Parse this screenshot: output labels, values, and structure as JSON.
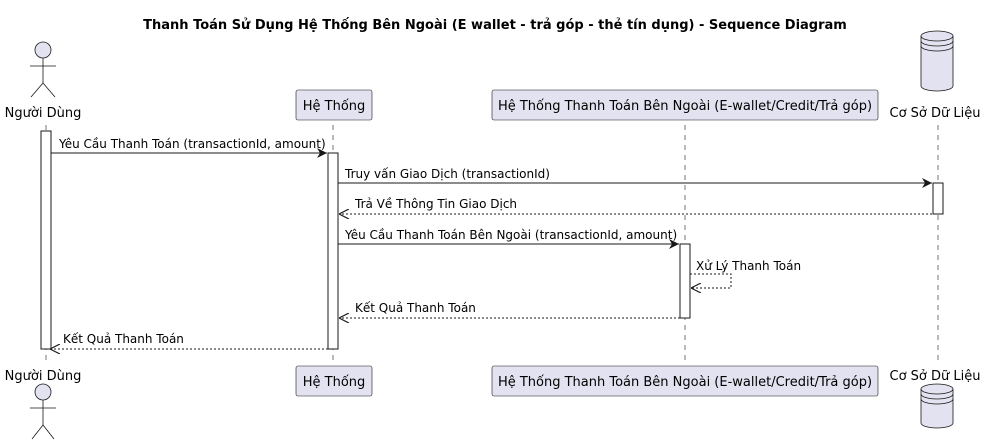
{
  "diagram": {
    "title": "Thanh Toán Sử Dụng Hệ Thống Bên Ngoài (E wallet - trả góp - thẻ tín dụng) - Sequence Diagram",
    "colors": {
      "participant_fill": "#E2E2F0",
      "line": "#181818",
      "background": "#FFFFFF"
    },
    "participants": [
      {
        "id": "user",
        "label": "Người Dùng",
        "kind": "actor",
        "icon": "actor-stick-figure"
      },
      {
        "id": "system",
        "label": "Hệ Thống",
        "kind": "participant"
      },
      {
        "id": "external",
        "label": "Hệ Thống Thanh Toán Bên Ngoài (E-wallet/Credit/Trả góp)",
        "kind": "participant"
      },
      {
        "id": "db",
        "label": "Cơ Sở Dữ Liệu",
        "kind": "database",
        "icon": "database-cylinder"
      }
    ],
    "messages": [
      {
        "from": "user",
        "to": "system",
        "label": "Yêu Cầu Thanh Toán (transactionId, amount)",
        "style": "solid"
      },
      {
        "from": "system",
        "to": "db",
        "label": "Truy vấn Giao Dịch (transactionId)",
        "style": "solid"
      },
      {
        "from": "db",
        "to": "system",
        "label": "Trả Về Thông Tin Giao Dịch",
        "style": "dashed"
      },
      {
        "from": "system",
        "to": "external",
        "label": "Yêu Cầu Thanh Toán Bên Ngoài (transactionId, amount)",
        "style": "solid"
      },
      {
        "from": "external",
        "to": "external",
        "label": "Xử Lý Thanh Toán",
        "style": "dashed"
      },
      {
        "from": "external",
        "to": "system",
        "label": "Kết Quả Thanh Toán",
        "style": "dashed"
      },
      {
        "from": "system",
        "to": "user",
        "label": "Kết Quả Thanh Toán",
        "style": "dashed"
      }
    ]
  }
}
